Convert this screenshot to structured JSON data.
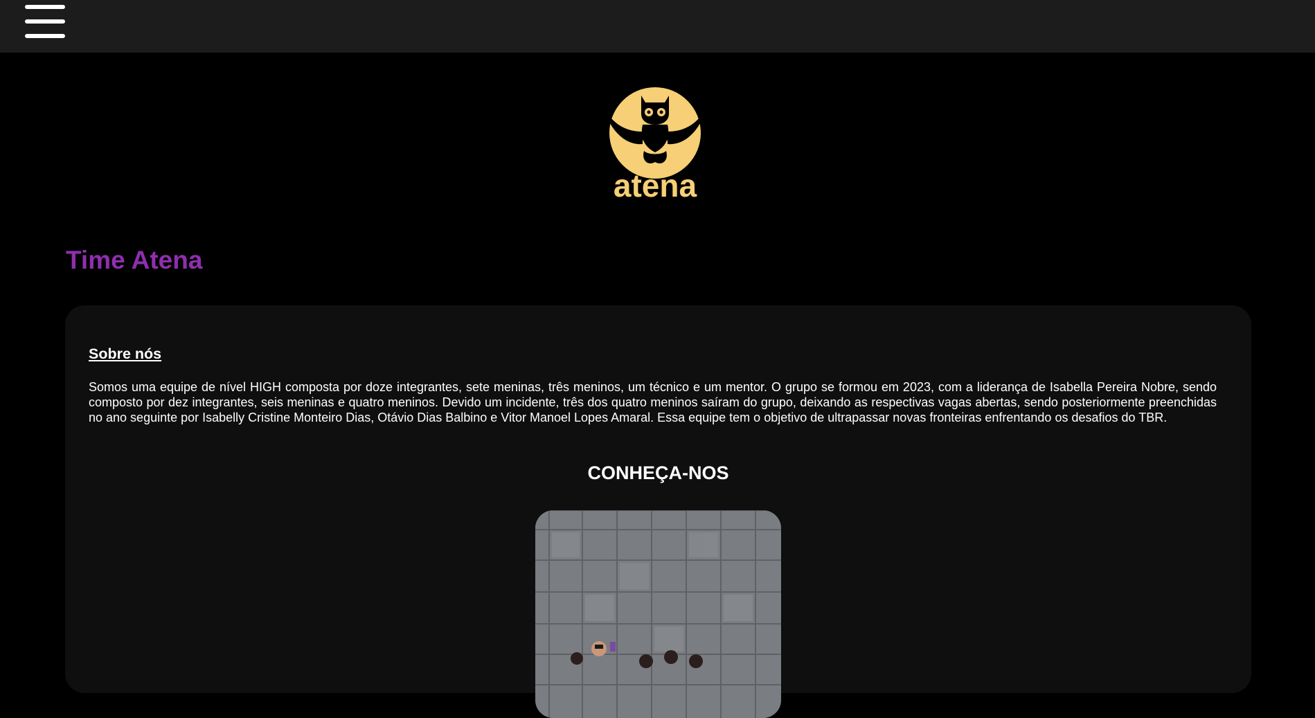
{
  "header": {
    "menu_icon": "hamburger-menu-icon"
  },
  "logo": {
    "text": "atena",
    "icon": "owl-icon",
    "color": "#f6cf76"
  },
  "page": {
    "title": "Time Atena",
    "title_color": "#8e2fae"
  },
  "about": {
    "heading": "Sobre nós",
    "text": "Somos uma equipe de nível HIGH composta por doze integrantes, sete meninas, três meninos, um técnico e um mentor. O grupo se formou em 2023, com a liderança de Isabella Pereira Nobre, sendo composto por dez integrantes, seis meninas e quatro meninos. Devido um incidente, três dos quatro meninos saíram do grupo, deixando as respectivas vagas abertas, sendo posteriormente preenchidas no ano seguinte por Isabelly Cristine Monteiro Dias, Otávio Dias Balbino e Vitor Manoel Lopes Amaral. Essa equipe tem o objetivo de ultrapassar novas fronteiras enfrentando os desafios do TBR."
  },
  "team": {
    "heading": "CONHEÇA-NOS",
    "photo_icon": "team-photo"
  }
}
